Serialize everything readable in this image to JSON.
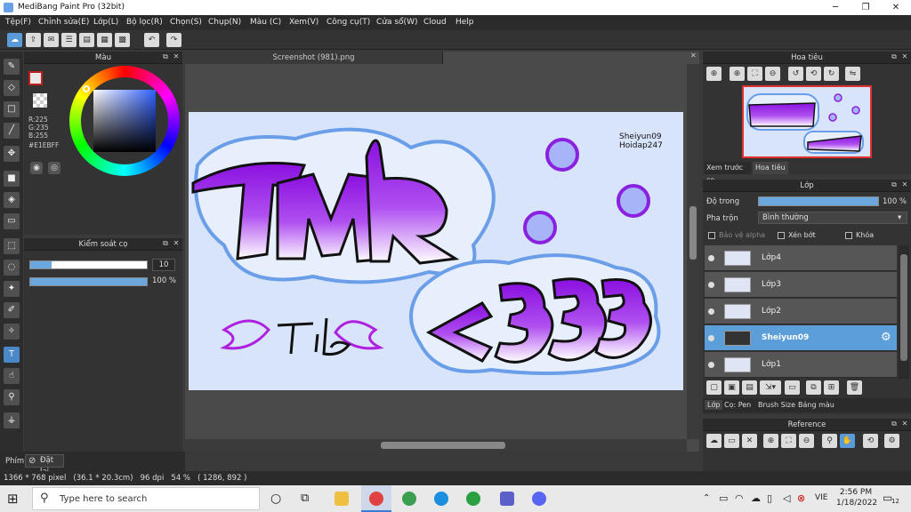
{
  "app": {
    "title": "MediBang Paint Pro (32bit)"
  },
  "menu": [
    "Tệp(F)",
    "Chỉnh sửa(E)",
    "Lớp(L)",
    "Bộ lọc(R)",
    "Chọn(S)",
    "Chụp(N)",
    "Màu (C)",
    "Xem(V)",
    "Công cụ(T)",
    "Cửa sổ(W)",
    "Cloud",
    "Help"
  ],
  "color_panel": {
    "title": "Màu",
    "r": "R:225",
    "g": "G:235",
    "b": "B:255",
    "hex": "#E1EBFF"
  },
  "brush_panel": {
    "title": "Kiểm soát cọ",
    "size": "10",
    "opacity": "100 %",
    "size_fraction": 0.18,
    "opacity_fraction": 1.0
  },
  "canvas": {
    "tab": "Screenshot (981).png",
    "credit1": "Sheiyun09",
    "credit2": "Hoidap247"
  },
  "navigator": {
    "title": "Hoa tiêu",
    "tab1": "Xem trước cọ",
    "tab2": "Hoa tiêu"
  },
  "layer_panel": {
    "title": "Lớp",
    "opacity_label": "Độ trong",
    "opacity_value": "100 %",
    "opacity_fraction": 1.0,
    "blend_label": "Pha trộn",
    "blend_value": "Bình thường",
    "protect_alpha": "Bảo vệ alpha",
    "clipping": "Xén bớt",
    "lock": "Khóa",
    "layers": [
      {
        "name": "Lớp4"
      },
      {
        "name": "Lớp3"
      },
      {
        "name": "Lớp2"
      },
      {
        "name": "Sheiyun09"
      },
      {
        "name": "Lớp1"
      }
    ],
    "tabs": [
      "Lớp",
      "Cọ: Pen",
      "Brush Size",
      "Bảng màu"
    ]
  },
  "reference": {
    "title": "Reference"
  },
  "bottom_left": {
    "tab": "Phím",
    "reset": "Đặt lại"
  },
  "status": {
    "text": "1366 * 768 pixel   (36.1 * 20.3cm)   96 dpi   54 %   ( 1286, 892 )"
  },
  "taskbar": {
    "search_placeholder": "Type here to search",
    "lang": "VIE",
    "time": "2:56 PM",
    "date": "1/18/2022",
    "notif": "12"
  },
  "colors": {
    "accent": "#5c9fd8",
    "purple": "#9b1fe8",
    "canvas_bg": "#d8e4fa"
  }
}
